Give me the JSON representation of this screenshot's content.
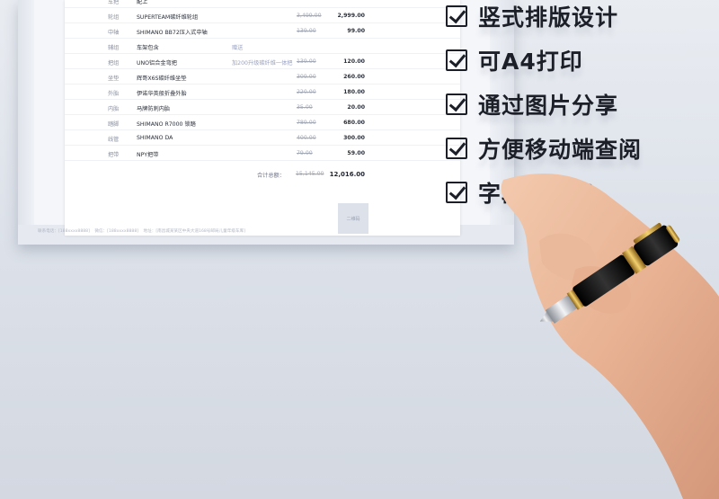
{
  "sheet": {
    "rows": [
      {
        "label": "车把",
        "name": "配上",
        "note": "",
        "orig": "",
        "price": ""
      },
      {
        "label": "轮组",
        "name": "SUPERTEAM碳纤维轮组",
        "note": "",
        "orig": "3,499.00",
        "price": "2,999.00"
      },
      {
        "label": "中轴",
        "name": "SHIMANO BB72压入式中轴",
        "note": "",
        "orig": "139.00",
        "price": "99.00"
      },
      {
        "label": "辅组",
        "name": "车架包含",
        "note": "赠送",
        "orig": "",
        "price": ""
      },
      {
        "label": "把组",
        "name": "UNO铝合金弯把",
        "note": "加200升级碳纤维一体把",
        "orig": "139.00",
        "price": "120.00"
      },
      {
        "label": "坐垫",
        "name": "辉哥X6S碳纤维坐垫",
        "note": "",
        "orig": "309.00",
        "price": "260.00"
      },
      {
        "label": "外胎",
        "name": "伊诺华英般折叠外胎",
        "note": "",
        "orig": "220.00",
        "price": "180.00"
      },
      {
        "label": "内胎",
        "name": "马牌防刺内胎",
        "note": "",
        "orig": "35.00",
        "price": "20.00"
      },
      {
        "label": "踏脚",
        "name": "SHIMANO R7000 锁踏",
        "note": "",
        "orig": "789.00",
        "price": "680.00"
      },
      {
        "label": "线管",
        "name": "SHIMANO DA",
        "note": "",
        "orig": "400.00",
        "price": "300.00"
      },
      {
        "label": "把带",
        "name": "NPY把带",
        "note": "",
        "orig": "79.00",
        "price": "59.00"
      }
    ],
    "total_label": "合计总额：",
    "total_orig": "15,145.00",
    "total_price": "12,016.00",
    "qr_label": "二维码",
    "footer": {
      "phone": "联系电话：[188xxxx8888]",
      "wechat": "微信：[188xxxx8888]",
      "address": "地址：[南昌城某某区中央大道168号邮局儿童年级车库]"
    }
  },
  "features": [
    "竖式排版设计",
    "可A4打印",
    "通过图片分享",
    "方便移动端查阅",
    "字段自定义"
  ],
  "colors": {
    "background": "#e0e4eb",
    "text_dark": "#1c1f27",
    "pen_gold": "#c99a2e",
    "pen_black": "#111111"
  }
}
